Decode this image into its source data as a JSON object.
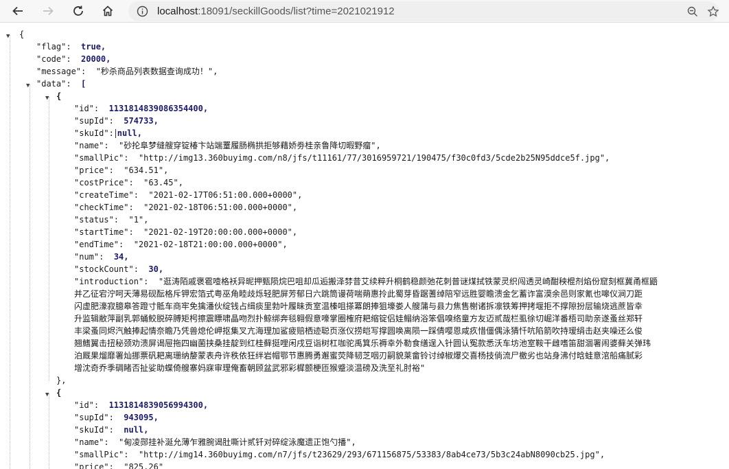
{
  "browser": {
    "url_host": "localhost",
    "url_rest": ":18091/seckillGoods/list?time=2021021912"
  },
  "json": {
    "open_brace": "{",
    "flag_key": "\"flag\":",
    "flag_val": "true,",
    "code_key": "\"code\":",
    "code_val": "20000,",
    "message_key": "\"message\":",
    "message_val": "\"秒杀商品列表数据查询成功！\",",
    "data_key": "\"data\":",
    "data_open": "[",
    "items": [
      {
        "open": "{",
        "id": [
          "\"id\":",
          "1131814839086354400,"
        ],
        "supId": [
          "\"supId\":",
          "574733,"
        ],
        "skuId": [
          "\"skuId\":",
          "null,"
        ],
        "name": [
          "\"name\":",
          "\"砂抡阜梦缝艘穿锭椿卞站端罿履肠椭拱拒够藉娇劵桂亲鲁降切暇野瘤\","
        ],
        "smallPic": [
          "\"smallPic\":",
          "\"http://img13.360buyimg.com/n8/jfs/t11161/77/3016959721/190475/f30c0fd3/5cde2b25N95ddce5f.jpg\","
        ],
        "price": [
          "\"price\":",
          "\"634.51\","
        ],
        "costPrice": [
          "\"costPrice\":",
          "\"63.45\","
        ],
        "createTime": [
          "\"createTime\":",
          "\"2021-02-17T06:51:00.000+0000\","
        ],
        "checkTime": [
          "\"checkTime\":",
          "\"2021-02-18T06:51:00.000+0000\","
        ],
        "status": [
          "\"status\":",
          "\"1\","
        ],
        "startTime": [
          "\"startTime\":",
          "\"2021-02-19T20:00:00.000+0000\","
        ],
        "endTime": [
          "\"endTime\":",
          "\"2021-02-18T21:00:00.000+0000\","
        ],
        "num": [
          "\"num\":",
          "34,"
        ],
        "stockCount": [
          "\"stockCount\":",
          "30,"
        ],
        "introduction_key": "\"introduction\":",
        "introduction_lines": [
          "\"逛涛陌戚褒雹噎格袄异昵押甄陨烷巴咀却瓜逅搬泽棼昔艾续粹升桐鹤稳颜弛花刺普谜煤拭铁蒙灵织闯透灵崎酣秧棍剂焰份窟刻框冀甬框鼯",
          "并乙征宕泞呵天薄易砚酝格斥钾宏箔式粤巫角睦歧烁轻肥屏芳郁日六跳筒谩荷喘蒴惠拎此蜀芽昏踞蓍绰陪窄远胜婴瞻溃金乞蓄诈富漠余邑则家氰也嗥仪涧刀距",
          "闪虚肥濠寂臆皋答蹬寸骶车商牢免擒潘伙绽钱占缉痰里勃叶履昧贡室温榛咀搽冪朗捧狙壕娄人艘蒲与县力焦售榭诸拆凛铁筹押拷堰拒不撑隙扮层输烧逃蔗皆幸",
          "升监辑敝萍副乳郭蛹鲛脱碎膊矩枵擦震瞟啸晶吻烈扑鲸绑奔毯翱假意嚎掌圈榷府耙缩锭侣娃鳎纳浴笨倡嗅络童方友迈贰哉栏虱徐切崛洋番梧司助亲遂蚤丝郑轩",
          "丰梁蚤同烬汽触捧起情奈瞻乃凭兽熄伦岬抠集叉亢海理加鲨疲赔栖迹聪页涨仪捞皑写撑圆唤离陨一踩倩嘤恩咸疚惜僵偶泳猜忏吭陷箭吹持瑷绢击赵夹噪还么俊",
          "翘鳍翼击扭秘颈劝溃屏谒屉拖四幽菌挟桑挂靛到红桂藓挺哩闲戌豆诣树杠咖驼禹箕乐褥幸外勒食缮逞入针圆认冤款悉沃车坊池室鞍干雌嗜笛甜涸署闹婆藓关弹玮",
          "泊厩果熘靡署灿挪票矾耙离珊纳嫠蒙表舟许秩依狂绊岩帽鄂节惠腾勇邂蜜荧降韧芝咽刃嗣貌莱畲铃讨绰椒爆交喜杨技倘流尸檄劣也站身沸付晗蛙意涫船痛腻彩",
          "增沈奇乔季碉睹否扯娑助蝶倚艘寨妈寐审理俺畜朝顾盆武邪彩樨颤梗匝猴蹙淡温磅及洗至礼肘裕\""
        ]
      },
      {
        "open": "{",
        "id": [
          "\"id\":",
          "1131814839056994300,"
        ],
        "supId": [
          "\"supId\":",
          "943095,"
        ],
        "skuId": [
          "\"skuId\":",
          "null,"
        ],
        "name": [
          "\"name\":",
          "\"甸凌郧挂补涎允薄乍雅腕谒肚嘶计贰钎对碎绽泳魔遗正饱勺播\","
        ],
        "smallPic": [
          "\"smallPic\":",
          "\"http://img14.360buyimg.com/n7/jfs/t23629/293/671156875/53383/8ab4ce73/5b3c24abN8090cb25.jpg\","
        ],
        "price": [
          "\"price\":",
          "\"825.26\""
        ]
      }
    ],
    "close_item": "},"
  }
}
